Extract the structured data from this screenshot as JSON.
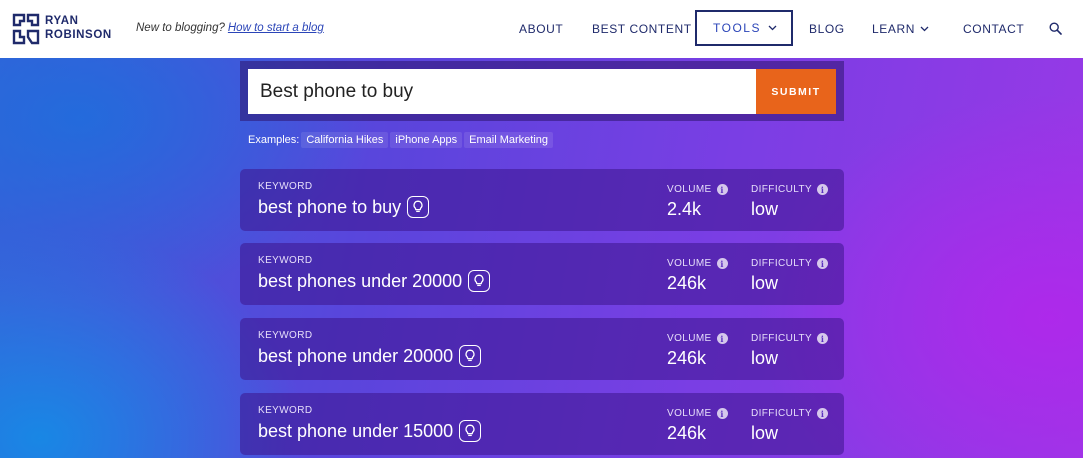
{
  "header": {
    "logo_line1": "RYAN",
    "logo_line2": "ROBINSON",
    "tagline": "New to blogging?",
    "tagline_link": "How to start a blog",
    "nav": {
      "about": "ABOUT",
      "best_content": "BEST CONTENT",
      "tools": "TOOLS",
      "blog": "BLOG",
      "learn": "LEARN",
      "contact": "CONTACT"
    },
    "brand_color": "#1f2a6b"
  },
  "search": {
    "value": "Best phone to buy",
    "submit_label": "SUBMIT",
    "submit_color": "#e8641b"
  },
  "examples": {
    "label": "Examples:",
    "items": [
      "California Hikes",
      "iPhone Apps",
      "Email Marketing"
    ]
  },
  "results": [
    {
      "keyword_label": "KEYWORD",
      "keyword": "best phone to buy",
      "volume_label": "VOLUME",
      "volume": "2.4k",
      "difficulty_label": "DIFFICULTY",
      "difficulty": "low"
    },
    {
      "keyword_label": "KEYWORD",
      "keyword": "best phones under 20000",
      "volume_label": "VOLUME",
      "volume": "246k",
      "difficulty_label": "DIFFICULTY",
      "difficulty": "low"
    },
    {
      "keyword_label": "KEYWORD",
      "keyword": "best phone under 20000",
      "volume_label": "VOLUME",
      "volume": "246k",
      "difficulty_label": "DIFFICULTY",
      "difficulty": "low"
    },
    {
      "keyword_label": "KEYWORD",
      "keyword": "best phone under 15000",
      "volume_label": "VOLUME",
      "volume": "246k",
      "difficulty_label": "DIFFICULTY",
      "difficulty": "low"
    }
  ],
  "icons": {
    "info": "i",
    "bulb": "lightbulb-icon",
    "search": "search-icon",
    "chevron": "chevron-down-icon"
  }
}
